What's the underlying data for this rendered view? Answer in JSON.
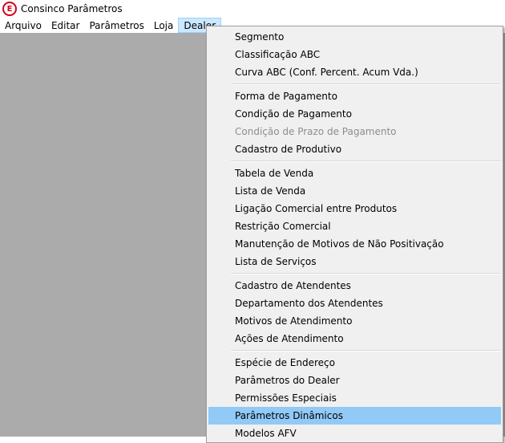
{
  "window": {
    "title": "Consinco Parâmetros",
    "icon_name": "consinco-e-icon",
    "icon_letter": "E",
    "icon_color": "#d0021b"
  },
  "menubar": {
    "items": [
      {
        "label": "Arquivo"
      },
      {
        "label": "Editar"
      },
      {
        "label": "Parâmetros"
      },
      {
        "label": "Loja"
      },
      {
        "label": "Dealer",
        "active": true
      }
    ]
  },
  "dealer_menu": {
    "groups": [
      [
        {
          "label": "Segmento"
        },
        {
          "label": "Classificação ABC"
        },
        {
          "label": "Curva ABC (Conf. Percent. Acum Vda.)"
        }
      ],
      [
        {
          "label": "Forma de Pagamento"
        },
        {
          "label": "Condição de Pagamento"
        },
        {
          "label": "Condição de Prazo de Pagamento",
          "disabled": true
        },
        {
          "label": "Cadastro de Produtivo"
        }
      ],
      [
        {
          "label": "Tabela de Venda"
        },
        {
          "label": "Lista de Venda"
        },
        {
          "label": "Ligação Comercial entre Produtos"
        },
        {
          "label": "Restrição Comercial"
        },
        {
          "label": "Manutenção de Motivos de Não Positivação"
        },
        {
          "label": "Lista de Serviços"
        }
      ],
      [
        {
          "label": "Cadastro de Atendentes"
        },
        {
          "label": "Departamento dos Atendentes"
        },
        {
          "label": "Motivos de Atendimento"
        },
        {
          "label": "Ações de Atendimento"
        }
      ],
      [
        {
          "label": "Espécie de Endereço"
        },
        {
          "label": "Parâmetros do Dealer"
        },
        {
          "label": "Permissões Especiais"
        },
        {
          "label": "Parâmetros Dinâmicos",
          "highlighted": true
        },
        {
          "label": "Modelos AFV"
        }
      ]
    ]
  },
  "colors": {
    "workspace": "#ababab",
    "menu_background": "#f0f0f0",
    "highlight": "#91c9f7",
    "active_menu": "#cce8ff",
    "disabled_text": "#8d8d8d"
  }
}
